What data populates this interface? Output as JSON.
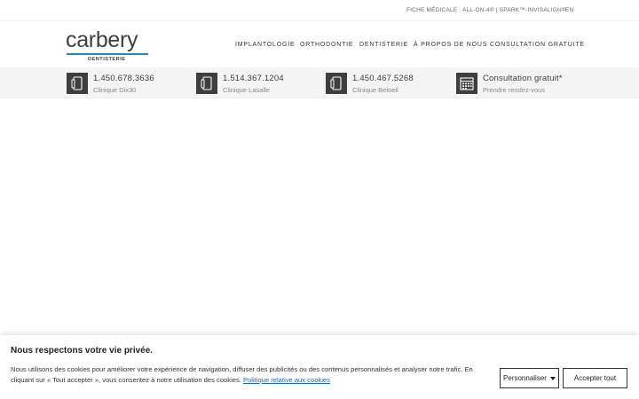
{
  "topbar": {
    "links": [
      "FICHE MÉDICALE",
      "ALL-ON-4® | SPARK™-INVISALIGN®",
      "EN"
    ]
  },
  "logo": {
    "word": "carbery",
    "sub": "DENTISTERIE"
  },
  "nav": {
    "items": [
      "IMPLANTOLOGIE",
      "ORTHODONTIE",
      "DENTISTERIE",
      "À PROPOS DE NOUS",
      "CONSULTATION GRATUITE"
    ]
  },
  "contacts": [
    {
      "main": "1.450.678.3636",
      "sub": "Clinique Dix30",
      "icon": "phone-icon"
    },
    {
      "main": "1.514.367.1204",
      "sub": "Clinique Lasalle",
      "icon": "phone-icon"
    },
    {
      "main": "1.450.467.5268",
      "sub": "Clinique Beloeil",
      "icon": "phone-icon"
    },
    {
      "main": "Consultation gratuit*",
      "sub": "Prendre rendez-vous",
      "icon": "calendar-icon"
    }
  ],
  "cookie": {
    "title": "Nous respectons votre vie privée.",
    "text": "Nous utilisons des cookies pour améliorer votre expérience de navigation, diffuser des publicités ou des contenus personnalisés et analyser notre trafic. En cliquant sur « Tout accepter », vous consentez à notre utilisation des cookies. ",
    "policy_link": "Politique relative aux cookies",
    "customize_label": "Personnaliser",
    "accept_label": "Accepter tout"
  },
  "colors": {
    "accent": "#1a8fc4",
    "icon_bg": "#3e3e3e",
    "link": "#1863dc"
  }
}
